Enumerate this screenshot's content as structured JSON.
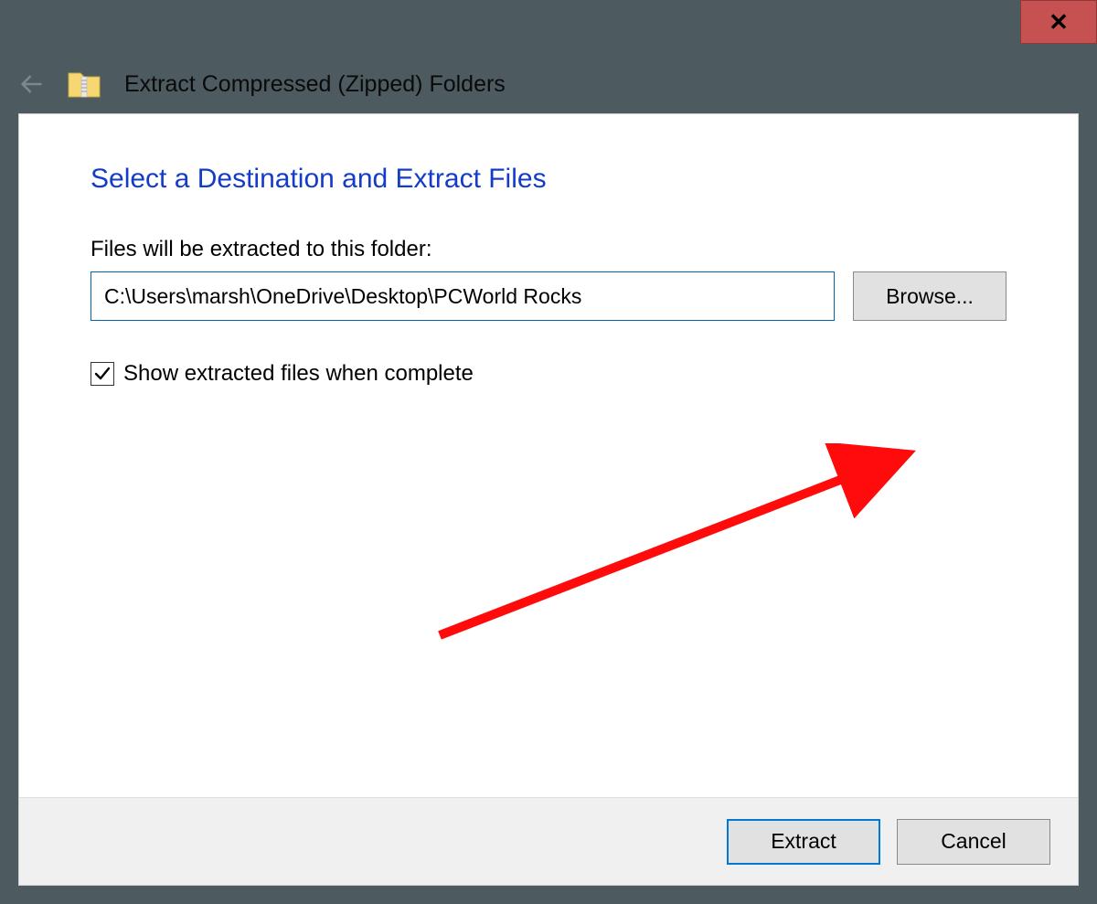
{
  "window": {
    "title": "Extract Compressed (Zipped) Folders",
    "close_glyph": "✕"
  },
  "main": {
    "heading": "Select a Destination and Extract Files",
    "instruction": "Files will be extracted to this folder:",
    "path_value": "C:\\Users\\marsh\\OneDrive\\Desktop\\PCWorld Rocks",
    "browse_label": "Browse...",
    "checkbox": {
      "label": "Show extracted files when complete",
      "checked": true
    }
  },
  "footer": {
    "extract_label": "Extract",
    "cancel_label": "Cancel"
  },
  "annotation": {
    "arrow_color": "#ff0b0b"
  }
}
